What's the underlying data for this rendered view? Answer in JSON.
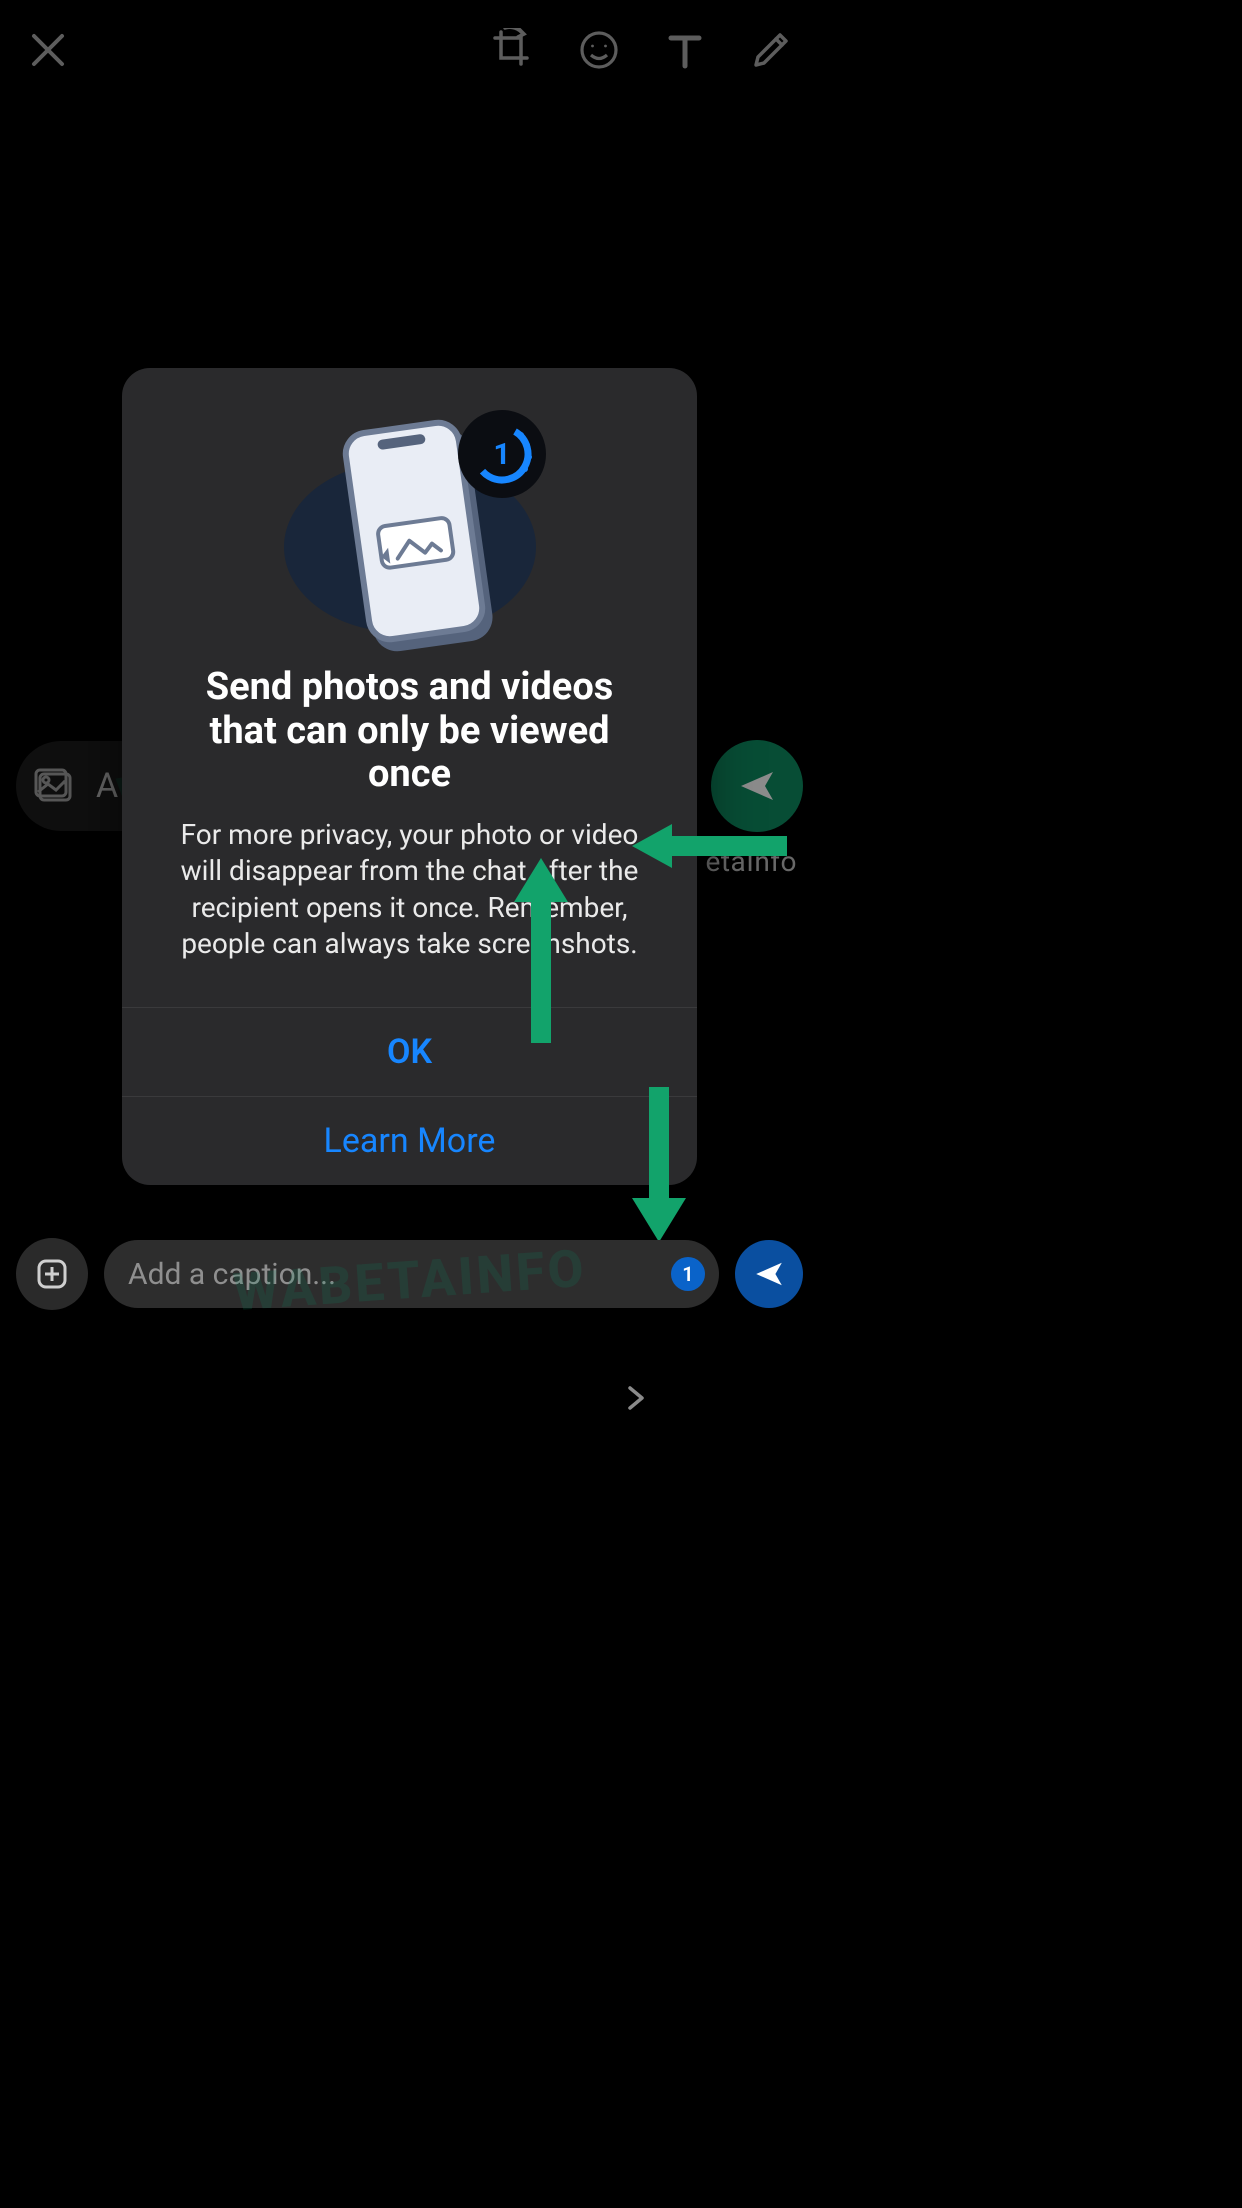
{
  "topbar": {
    "close": "Close",
    "crop": "Crop/Rotate",
    "emoji": "Emoji",
    "text": "Text",
    "draw": "Draw"
  },
  "caption1": {
    "prefix_visible": "A",
    "placeholder": "Add a caption..."
  },
  "betainfo_label": "etaInfo",
  "caption2": {
    "placeholder": "Add a caption...",
    "viewonce_badge": "1"
  },
  "dialog": {
    "title": "Send photos and videos that can only be viewed once",
    "description": "For more privacy, your photo or video will disappear from the chat after the recipient opens it once. Remember, people can always take screenshots.",
    "ok_label": "OK",
    "learn_label": "Learn More",
    "badge_digit": "1"
  },
  "watermark": "WABETAINFO",
  "watermark2": "WABETAINFO",
  "colors": {
    "accent_green": "#0e8c62",
    "accent_blue": "#1786ff",
    "send_blue": "#0a4fa0"
  }
}
